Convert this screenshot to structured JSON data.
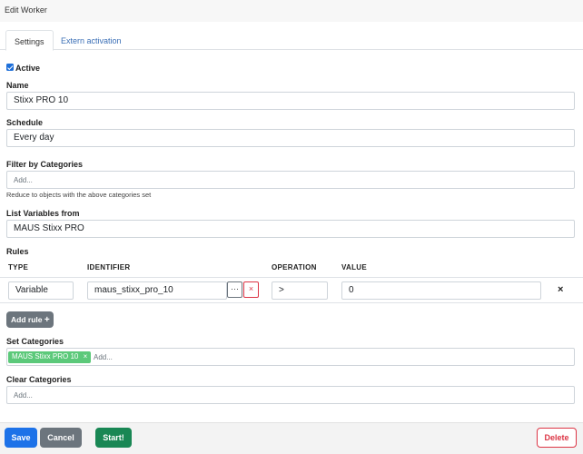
{
  "window": {
    "title": "Edit Worker"
  },
  "tabs": [
    {
      "label": "Settings",
      "active": true
    },
    {
      "label": "Extern activation",
      "active": false
    }
  ],
  "form": {
    "active": {
      "label": "Active",
      "checked": true
    },
    "name": {
      "label": "Name",
      "value": "Stixx PRO 10"
    },
    "schedule": {
      "label": "Schedule",
      "value": "Every day"
    },
    "filter_categories": {
      "label": "Filter by Categories",
      "placeholder": "Add...",
      "help": "Reduce to objects with the above categories set"
    },
    "list_variables": {
      "label": "List Variables from",
      "value": "MAUS Stixx PRO"
    },
    "rules": {
      "label": "Rules",
      "columns": [
        "TYPE",
        "IDENTIFIER",
        "OPERATION",
        "VALUE"
      ],
      "rows": [
        {
          "type": "Variable",
          "identifier": "maus_stixx_pro_10",
          "operation": ">",
          "value": "0"
        }
      ],
      "more_button": "···",
      "clear_button": "×",
      "remove_button": "×",
      "add_rule_label": "Add rule",
      "add_rule_icon": "+"
    },
    "set_categories": {
      "label": "Set Categories",
      "tags": [
        {
          "label": "MAUS Stixx PRO 10",
          "remove": "×"
        }
      ],
      "placeholder": "Add..."
    },
    "clear_categories": {
      "label": "Clear Categories",
      "placeholder": "Add..."
    }
  },
  "footer": {
    "save_label": "Save",
    "cancel_label": "Cancel",
    "start_label": "Start!",
    "delete_label": "Delete"
  },
  "colors": {
    "primary": "#1d72e8",
    "secondary": "#6c757d",
    "success": "#198754",
    "danger": "#dc3545",
    "tag": "#5cc97a",
    "link": "#3b6fb6"
  }
}
